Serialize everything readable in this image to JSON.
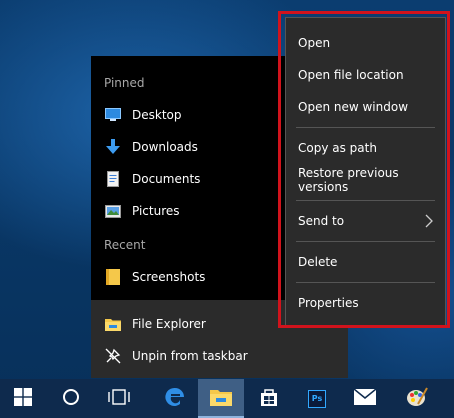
{
  "jumplist": {
    "pinned_header": "Pinned",
    "pinned": [
      {
        "label": "Desktop",
        "icon": "desktop-icon"
      },
      {
        "label": "Downloads",
        "icon": "download-arrow-icon"
      },
      {
        "label": "Documents",
        "icon": "document-icon"
      },
      {
        "label": "Pictures",
        "icon": "pictures-icon"
      }
    ],
    "recent_header": "Recent",
    "recent": [
      {
        "label": "Screenshots",
        "icon": "folder-icon"
      }
    ],
    "actions": [
      {
        "label": "File Explorer",
        "icon": "file-explorer-icon"
      },
      {
        "label": "Unpin from taskbar",
        "icon": "unpin-icon"
      }
    ]
  },
  "context_menu": {
    "items": {
      "open": "Open",
      "open_file_location": "Open file location",
      "open_new_window": "Open new window",
      "copy_as_path": "Copy as path",
      "restore_previous_versions": "Restore previous versions",
      "send_to": "Send to",
      "delete": "Delete",
      "properties": "Properties"
    }
  },
  "taskbar": {
    "ps_label": "Ps",
    "buttons": [
      "windows-logo-icon",
      "cortana-circle-icon",
      "task-view-icon",
      "edge-icon",
      "file-explorer-icon",
      "store-icon",
      "photoshop-icon",
      "mail-icon",
      "paint-icon"
    ]
  },
  "colors": {
    "menu_bg": "#2b2b2b",
    "jumplist_bg": "#000000",
    "highlight": "#d1131c",
    "taskbar_bg": "#0e2a4d"
  }
}
